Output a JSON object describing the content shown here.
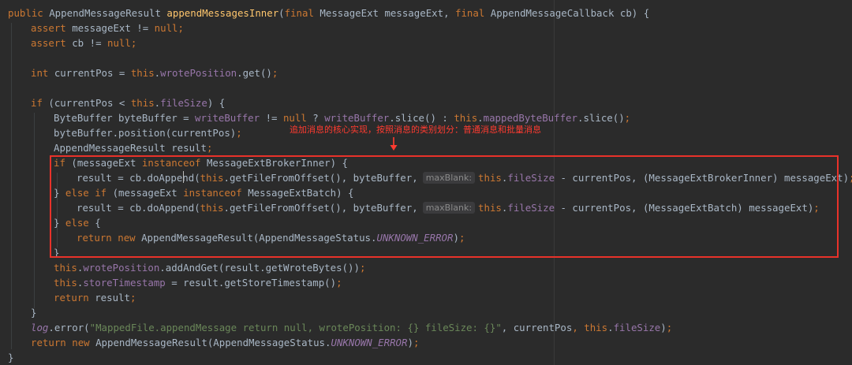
{
  "code": {
    "l1": {
      "kw_public": "public",
      "type": " AppendMessageResult ",
      "method": "appendMessagesInner",
      "p1": "(",
      "kw_final1": "final",
      "t1": " MessageExt messageExt, ",
      "kw_final2": "final",
      "t2": " AppendMessageCallback cb) {"
    },
    "l2": {
      "kw": "assert",
      "t": " messageExt != ",
      "nl": "null",
      "end": ";"
    },
    "l3": {
      "kw": "assert",
      "t": " cb != ",
      "nl": "null",
      "end": ";"
    },
    "l4": {
      "kw": "int",
      "t": " currentPos = ",
      "th": "this",
      "dot": ".",
      "fld": "wrotePosition",
      "t2": ".get()",
      "end": ";"
    },
    "l5": {
      "kw": "if",
      "t": " (currentPos < ",
      "th": "this",
      "dot": ".",
      "fld": "fileSize",
      "t2": ") {"
    },
    "l6": {
      "t": "ByteBuffer byteBuffer = ",
      "f1": "writeBuffer",
      "t2": " != ",
      "nl": "null",
      "t3": " ? ",
      "f2": "writeBuffer",
      "t4": ".slice() : ",
      "th": "this",
      "dot": ".",
      "f3": "mappedByteBuffer",
      "t5": ".slice()",
      "end": ";"
    },
    "l7": {
      "t": "byteBuffer.position(currentPos)",
      "end": ";"
    },
    "l8": {
      "t": "AppendMessageResult result",
      "end": ";"
    },
    "l9": {
      "kw": "if",
      "t": " (messageExt ",
      "kw2": "instanceof",
      "t2": " MessageExtBrokerInner) {"
    },
    "l10": {
      "t": "result = cb.doAppend(",
      "th": "this",
      "t2": ".getFileFromOffset(), byteBuffer,",
      "hint": "maxBlank:",
      "th2": "this",
      "dot": ".",
      "fld": "fileSize",
      "t3": " - currentPos, (MessageExtBrokerInner) messageExt)",
      "end": ";"
    },
    "l11": {
      "t": "} ",
      "kw": "else if",
      "t2": " (messageExt ",
      "kw2": "instanceof",
      "t3": " MessageExtBatch) {"
    },
    "l12": {
      "t": "result = cb.doAppend(",
      "th": "this",
      "t2": ".getFileFromOffset(), byteBuffer,",
      "hint": "maxBlank:",
      "th2": "this",
      "dot": ".",
      "fld": "fileSize",
      "t3": " - currentPos, (MessageExtBatch) messageExt)",
      "end": ";"
    },
    "l13": {
      "t": "} ",
      "kw": "else",
      "t2": " {"
    },
    "l14": {
      "kw": "return",
      "sp": " ",
      "kw2": "new",
      "t": " AppendMessageResult(AppendMessageStatus.",
      "cst": "UNKNOWN_ERROR",
      "t2": ")",
      "end": ";"
    },
    "l15": {
      "t": "}"
    },
    "l16": {
      "th": "this",
      "dot": ".",
      "fld": "wrotePosition",
      "t": ".addAndGet(result.getWroteBytes())",
      "end": ";"
    },
    "l17": {
      "th": "this",
      "dot": ".",
      "fld": "storeTimestamp",
      "t": " = result.getStoreTimestamp()",
      "end": ";"
    },
    "l18": {
      "kw": "return",
      "t": " result",
      "end": ";"
    },
    "l19": {
      "t": "}"
    },
    "l20": {
      "log": "log",
      "t": ".error(",
      "str": "\"MappedFile.appendMessage return null, wrotePosition: {} fileSize: {}\"",
      "t2": ", currentPos",
      "comma": ", ",
      "th": "this",
      "dot": ".",
      "fld": "fileSize",
      "t3": ")",
      "end": ";"
    },
    "l21": {
      "kw": "return",
      "sp": " ",
      "kw2": "new",
      "t": " AppendMessageResult(AppendMessageStatus.",
      "cst": "UNKNOWN_ERROR",
      "t2": ")",
      "end": ";"
    },
    "l22": {
      "t": "}"
    }
  },
  "annotation": {
    "text": "追加消息的核心实现，按照消息的类别划分：普通消息和批量消息"
  },
  "colors": {
    "background": "#2b2b2b",
    "keyword": "#cc7832",
    "method": "#ffc66d",
    "field": "#9876aa",
    "string": "#6a8759",
    "text": "#a9b7c6",
    "highlight_box": "#e8322a",
    "annotation": "#ff3b30"
  }
}
